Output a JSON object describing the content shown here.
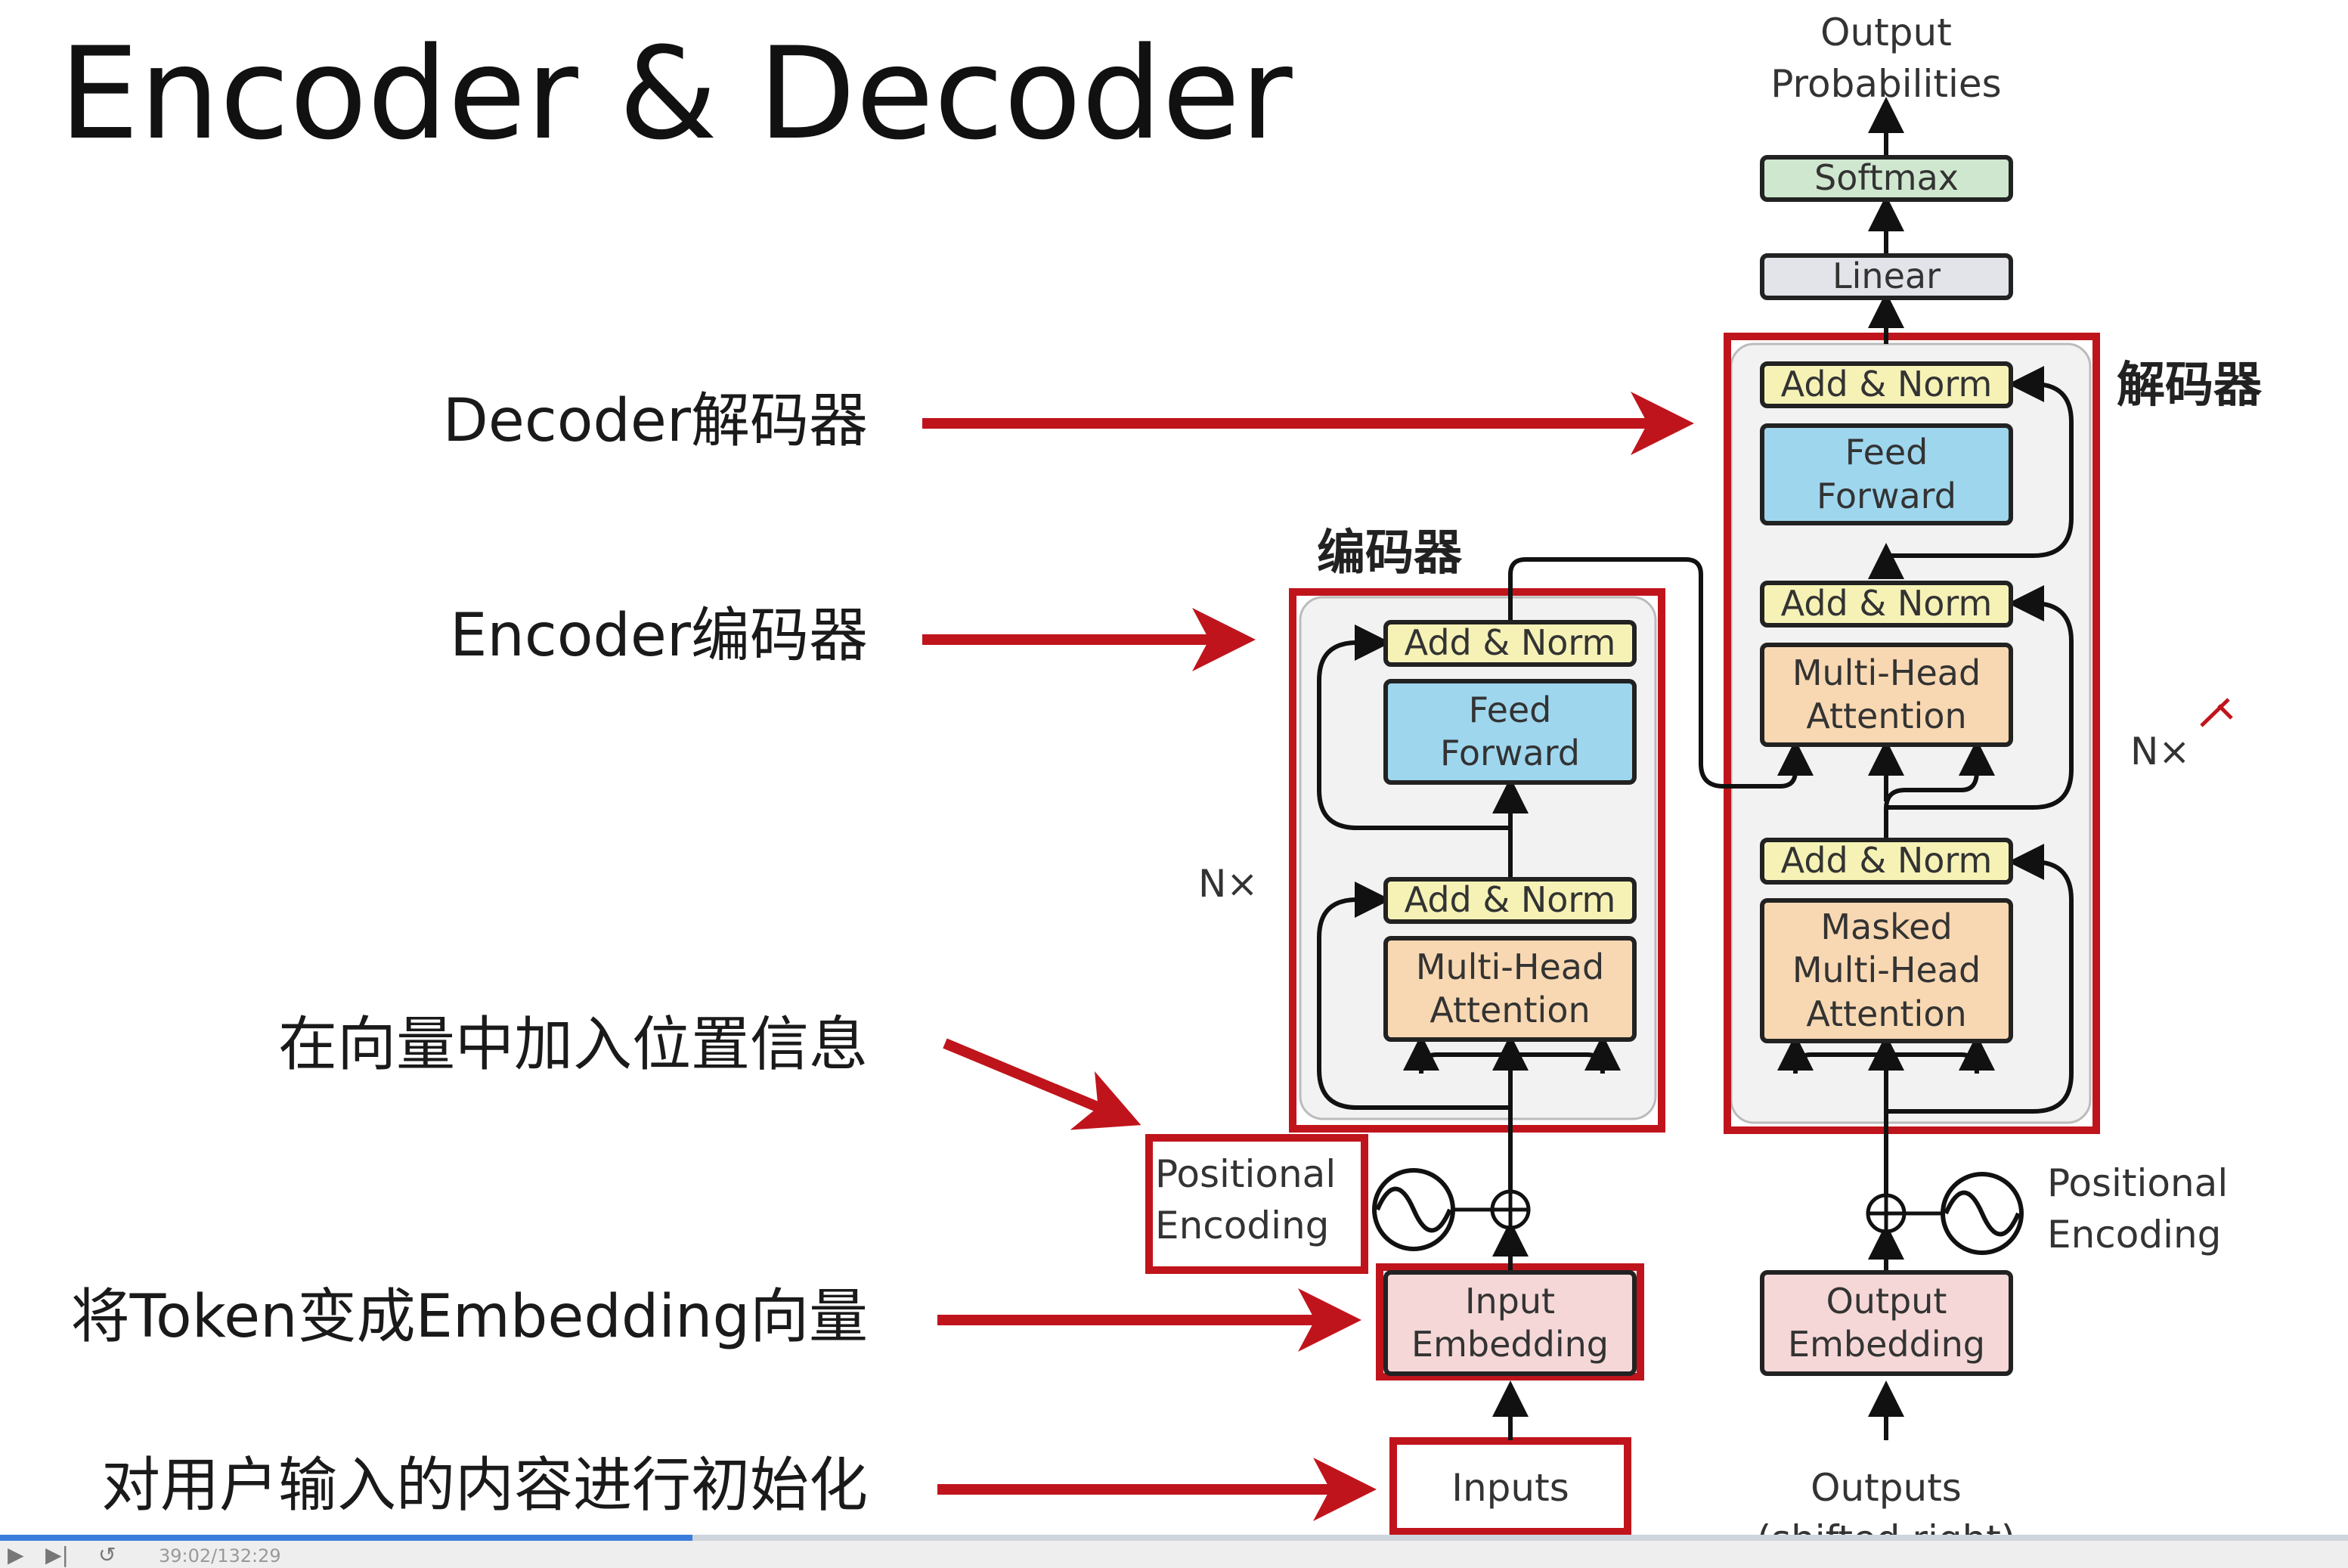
{
  "title": "Encoder & Decoder",
  "annotations": {
    "decoder": "Decoder解码器",
    "encoder": "Encoder编码器",
    "positional": "在向量中加入位置信息",
    "embedding": "将Token变成Embedding向量",
    "inputs": "对用户输入的内容进行初始化"
  },
  "diagram": {
    "output_probabilities": "Output\nProbabilities",
    "softmax": "Softmax",
    "linear": "Linear",
    "decoder_cn": "解码器",
    "encoder_cn": "编码器",
    "nx_encoder": "N×",
    "nx_decoder": "N×",
    "add_norm": "Add & Norm",
    "feed_forward": "Feed\nForward",
    "multi_head_attention": "Multi-Head\nAttention",
    "masked_mha": "Masked\nMulti-Head\nAttention",
    "positional_encoding": "Positional\nEncoding",
    "input_embedding": "Input\nEmbedding",
    "output_embedding": "Output\nEmbedding",
    "inputs": "Inputs",
    "outputs": "Outputs\n(shifted right)"
  },
  "colors": {
    "highlight_red": "#c0141c",
    "add_norm": "#f6f2b6",
    "feed_forward": "#9ed6ee",
    "attention": "#f8d8b2",
    "embedding": "#f5d7d7",
    "softmax": "#cfe7cf",
    "linear": "#e3e4ea",
    "progress": "#3b7ddd"
  },
  "player": {
    "timecode": "39:02/132:29",
    "progress": 0.295
  }
}
